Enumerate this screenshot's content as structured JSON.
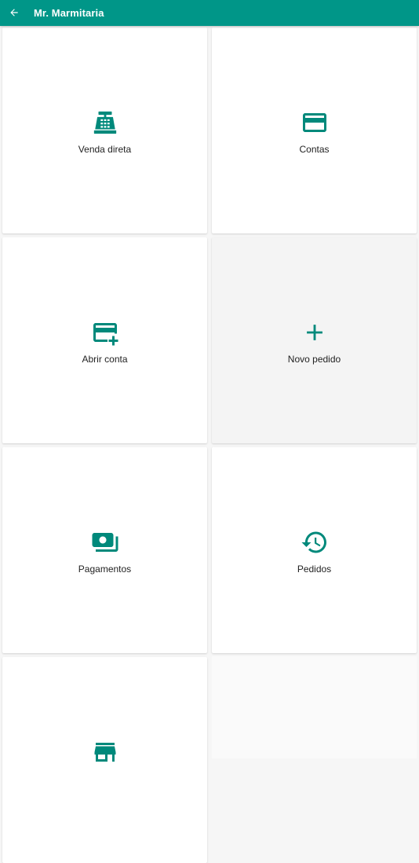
{
  "appbar": {
    "title": "Mr. Marmitaria",
    "color": "#009688",
    "back_icon": "arrow-back-icon"
  },
  "accent_color": "#00897b",
  "menu": [
    {
      "label": "Venda direta",
      "icon": "cash-register-icon"
    },
    {
      "label": "Contas",
      "icon": "credit-card-icon"
    },
    {
      "label": "Abrir conta",
      "icon": "credit-card-plus-icon"
    },
    {
      "label": "Novo pedido",
      "icon": "plus-icon"
    },
    {
      "label": "Pagamentos",
      "icon": "cash-payments-icon"
    },
    {
      "label": "Pedidos",
      "icon": "history-icon"
    },
    {
      "label": "",
      "icon": "store-icon"
    }
  ]
}
